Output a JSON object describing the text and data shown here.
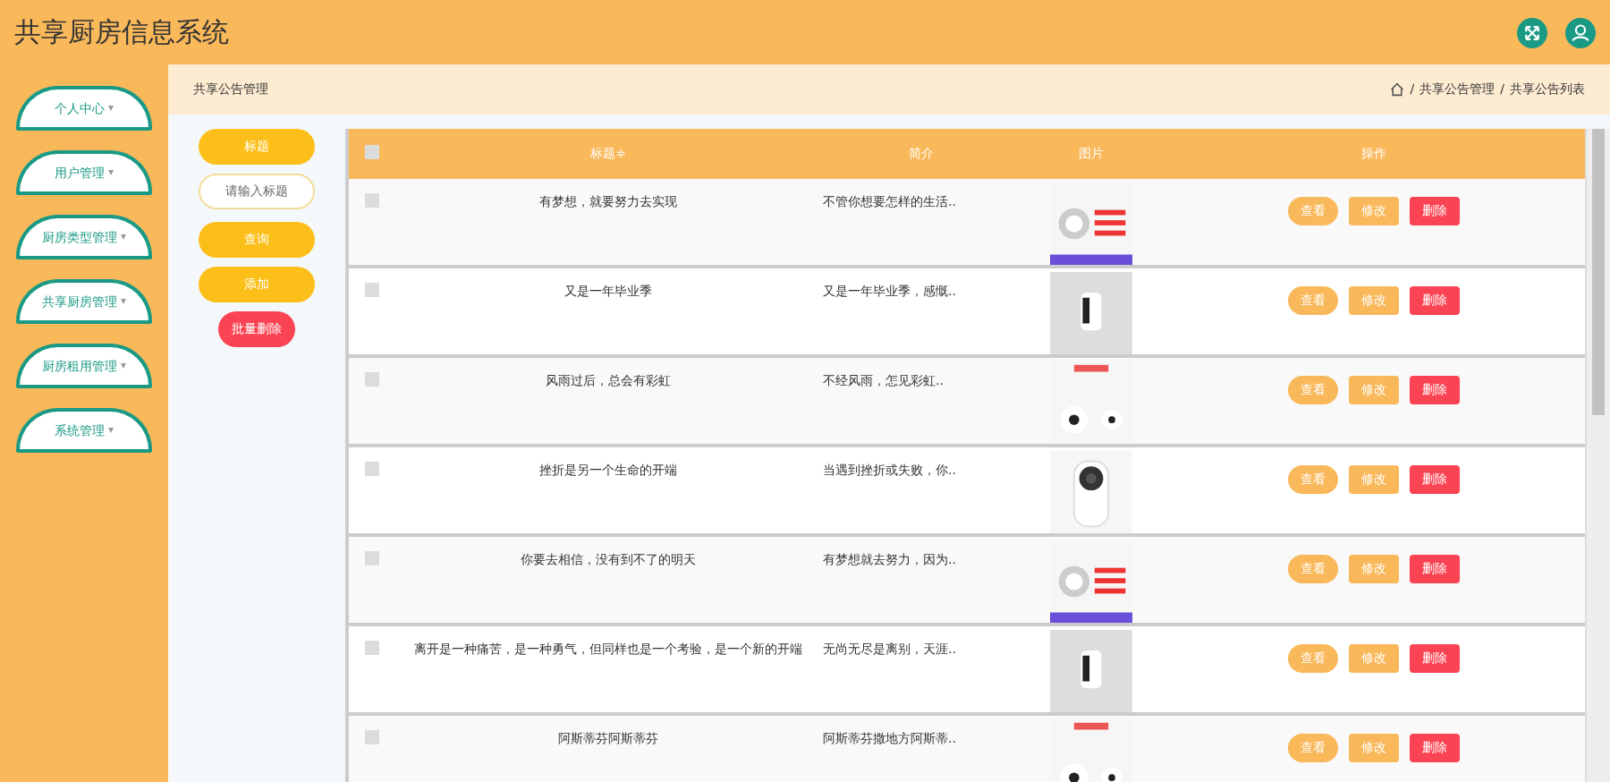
{
  "header": {
    "title": "共享厨房信息系统"
  },
  "sidebar": {
    "items": [
      {
        "label": "个人中心",
        "caret": "▾"
      },
      {
        "label": "用户管理",
        "caret": "▾"
      },
      {
        "label": "厨房类型管理",
        "caret": "▾"
      },
      {
        "label": "共享厨房管理",
        "caret": "▾"
      },
      {
        "label": "厨房租用管理",
        "caret": "▾"
      },
      {
        "label": "系统管理",
        "caret": "▾"
      }
    ]
  },
  "page": {
    "title": "共享公告管理",
    "breadcrumb": [
      {
        "separator": "/",
        "label": "共享公告管理"
      },
      {
        "separator": "/",
        "label": "共享公告列表"
      }
    ]
  },
  "search": {
    "label": "标题",
    "placeholder": "请输入标题",
    "buttons": [
      {
        "label": "查询",
        "kind": "primary"
      },
      {
        "label": "添加",
        "kind": "primary"
      },
      {
        "label": "批量删除",
        "kind": "danger"
      }
    ]
  },
  "table": {
    "select_all": {
      "checked": false
    },
    "columns": [
      "标题≑",
      "简介",
      "图片",
      "操作"
    ],
    "rows": [
      {
        "checked": false,
        "title": "有梦想，就要努力去实现",
        "brief": "不管你想要怎样的生活..",
        "picture": {
          "kind": "picture"
        },
        "actions": [
          "查看",
          "修改",
          "删除"
        ]
      },
      {
        "checked": false,
        "title": "又是一年毕业季",
        "brief": "又是一年毕业季，感慨..",
        "picture": {
          "kind": "picture"
        },
        "actions": [
          "查看",
          "修改",
          "删除"
        ]
      },
      {
        "checked": false,
        "title": "风雨过后，总会有彩虹",
        "brief": "不经风雨，怎见彩虹..",
        "picture": {
          "kind": "picture"
        },
        "actions": [
          "查看",
          "修改",
          "删除"
        ]
      },
      {
        "checked": false,
        "title": "挫折是另一个生命的开端",
        "brief": "当遇到挫折或失败，你..",
        "picture": {
          "kind": "picture"
        },
        "actions": [
          "查看",
          "修改",
          "删除"
        ]
      },
      {
        "checked": false,
        "title": "你要去相信，没有到不了的明天",
        "brief": "有梦想就去努力，因为..",
        "picture": {
          "kind": "picture"
        },
        "actions": [
          "查看",
          "修改",
          "删除"
        ]
      },
      {
        "checked": false,
        "title": "离开是一种痛苦，是一种勇气，但同样也是一个考验，是一个新的开端",
        "brief": "无尚无尽是离别，天涯..",
        "picture": {
          "kind": "picture"
        },
        "actions": [
          "查看",
          "修改",
          "删除"
        ]
      },
      {
        "checked": false,
        "title": "阿斯蒂芬阿斯蒂芬",
        "brief": "阿斯蒂芬撒地方阿斯蒂..",
        "picture": {
          "kind": "picture"
        },
        "actions": [
          "查看",
          "修改",
          "删除"
        ]
      }
    ]
  }
}
